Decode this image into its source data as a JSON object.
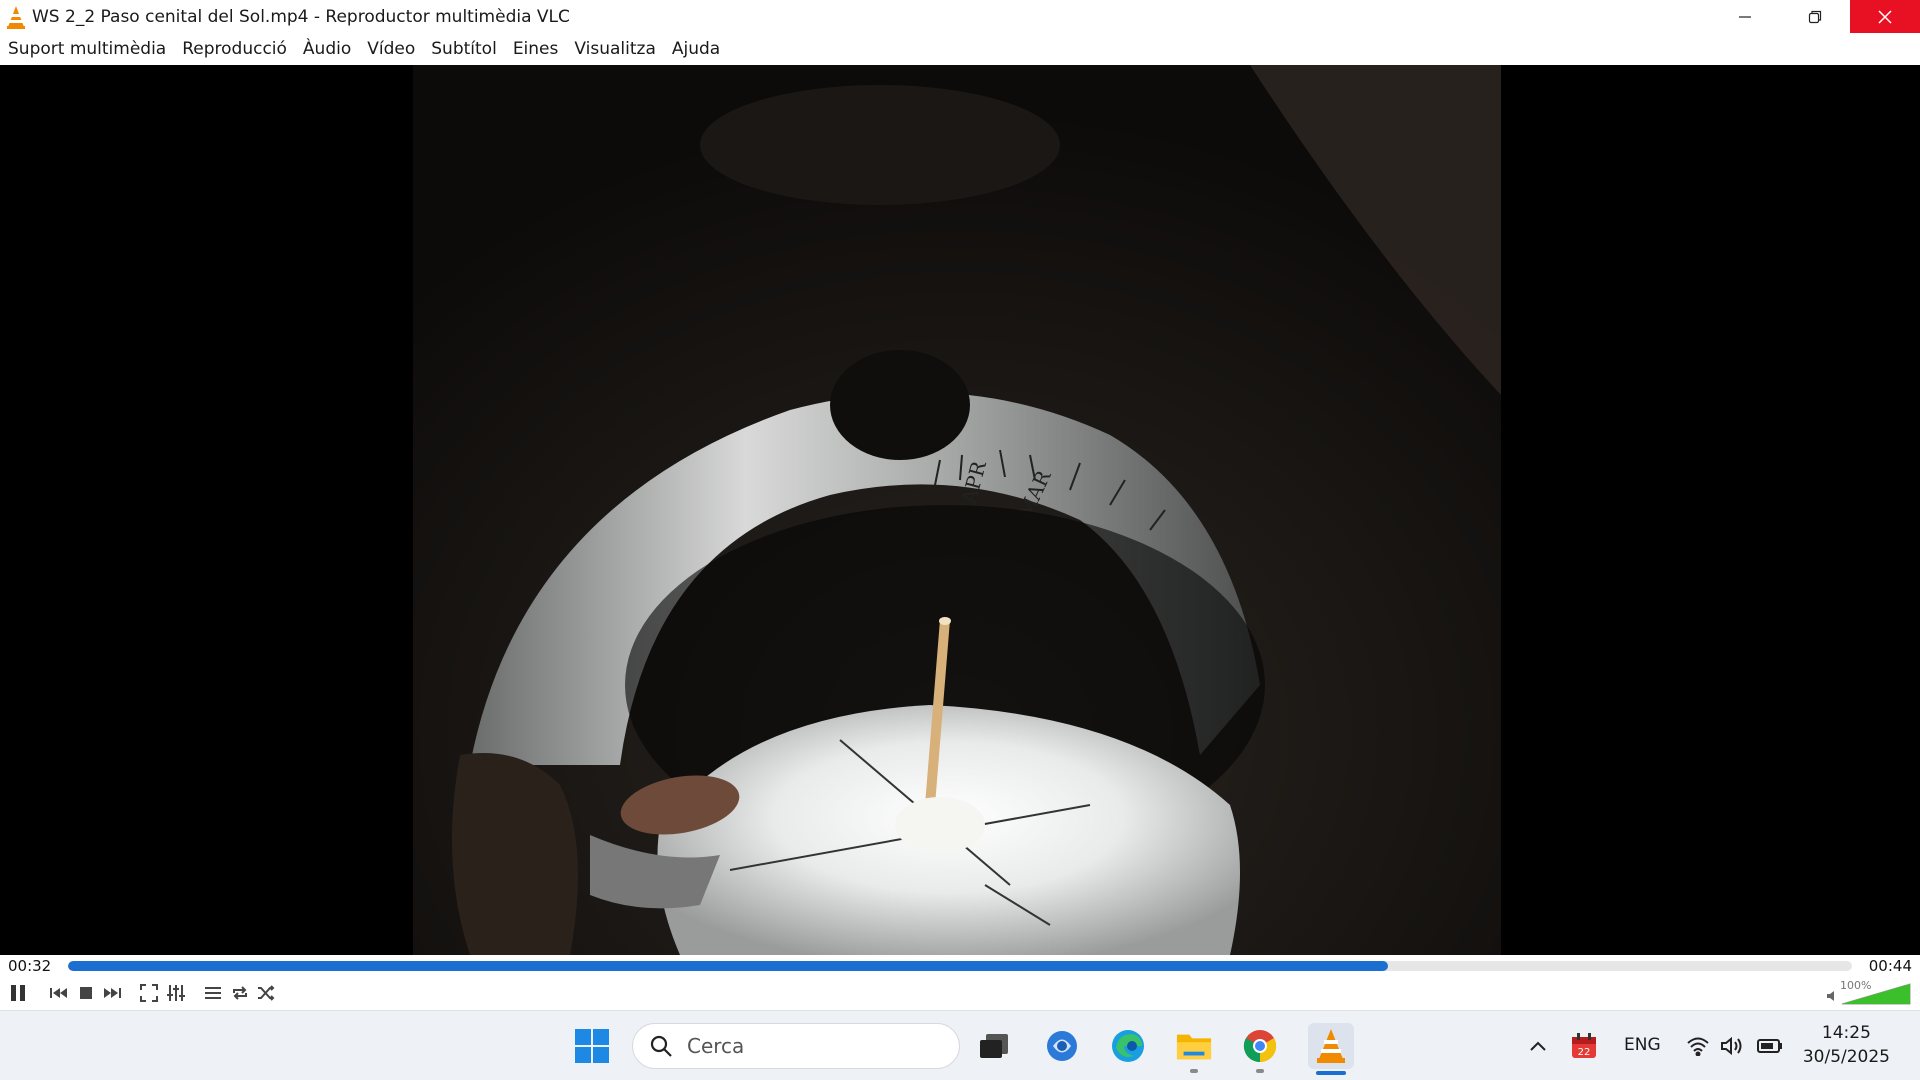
{
  "window": {
    "title": "WS 2_2 Paso cenital del Sol.mp4 - Reproductor multimèdia VLC",
    "minimize_icon": "minimize-icon",
    "restore_icon": "restore-icon",
    "close_icon": "close-icon"
  },
  "menu": {
    "items": [
      "Suport multimèdia",
      "Reproducció",
      "Àudio",
      "Vídeo",
      "Subtítol",
      "Eines",
      "Visualitza",
      "Ajuda"
    ]
  },
  "video": {
    "dial_labels": [
      "APR",
      "MAR"
    ]
  },
  "player": {
    "current_time": "00:32",
    "total_time": "00:44",
    "progress": 0.74,
    "volume_label": "100%",
    "volume_level": 1.0,
    "accent_color": "#1b6fd0"
  },
  "taskbar": {
    "search_placeholder": "Cerca",
    "language": "ENG",
    "calendar_badge": "22",
    "time": "14:25",
    "date": "30/5/2025"
  }
}
